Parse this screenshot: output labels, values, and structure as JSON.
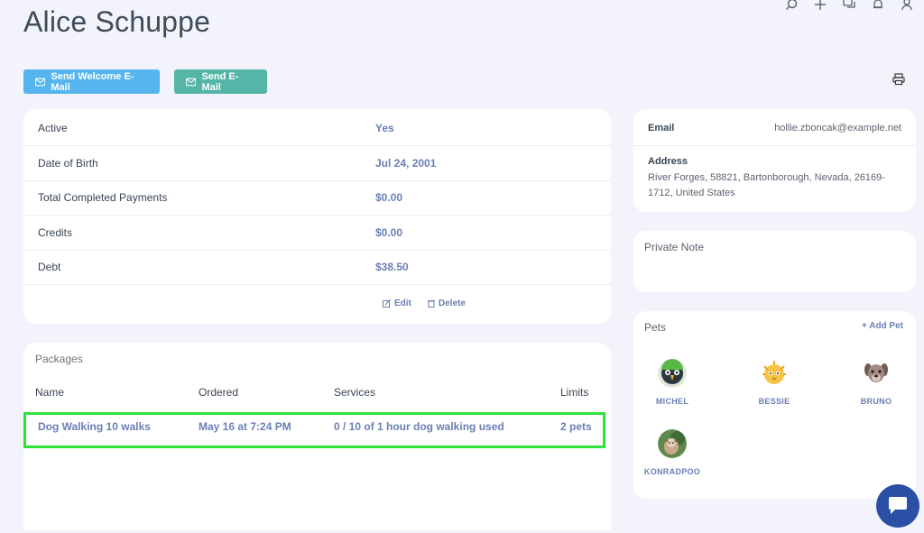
{
  "page": {
    "title": "Alice Schuppe"
  },
  "toolbar": {
    "welcome_label": "Send Welcome E-Mail",
    "email_label": "Send E-Mail"
  },
  "info": {
    "rows": [
      {
        "label": "Active",
        "value": "Yes"
      },
      {
        "label": "Date of Birth",
        "value": "Jul 24, 2001"
      },
      {
        "label": "Total Completed Payments",
        "value": "$0.00"
      },
      {
        "label": "Credits",
        "value": "$0.00"
      },
      {
        "label": "Debt",
        "value": "$38.50"
      }
    ],
    "edit_label": "Edit",
    "delete_label": "Delete"
  },
  "packages": {
    "title": "Packages",
    "columns": [
      "Name",
      "Ordered",
      "Services",
      "Limits"
    ],
    "rows": [
      {
        "name": "Dog Walking 10 walks",
        "ordered": "May 16 at 7:24 PM",
        "services": "0 / 10 of 1 hour dog walking used",
        "limits": "2 pets"
      }
    ]
  },
  "contact": {
    "email_label": "Email",
    "email_value": "hollie.zboncak@example.net",
    "address_label": "Address",
    "address_line1": "River Forges, 58821, Bartonborough, Nevada, 26169-",
    "address_line2": "1712, United States"
  },
  "note": {
    "label": "Private Note"
  },
  "pets": {
    "title": "Pets",
    "add_label": "+ Add Pet",
    "items": [
      {
        "name": "MICHEL"
      },
      {
        "name": "BESSIE"
      },
      {
        "name": "BRUNO"
      },
      {
        "name": "KONRADPOO"
      }
    ]
  },
  "icons": {
    "top": [
      "search-icon",
      "plus-icon",
      "chat-icon",
      "bell-icon",
      "user-icon"
    ],
    "print": "printer-icon",
    "chat_launcher": "chat-bubble-icon"
  },
  "colors": {
    "welcome_button": "#56b5ee",
    "email_button": "#55b5a7",
    "link_value": "#6b7fb5",
    "highlight": "#2fe23a",
    "chat_launcher": "#2c4fa6"
  }
}
